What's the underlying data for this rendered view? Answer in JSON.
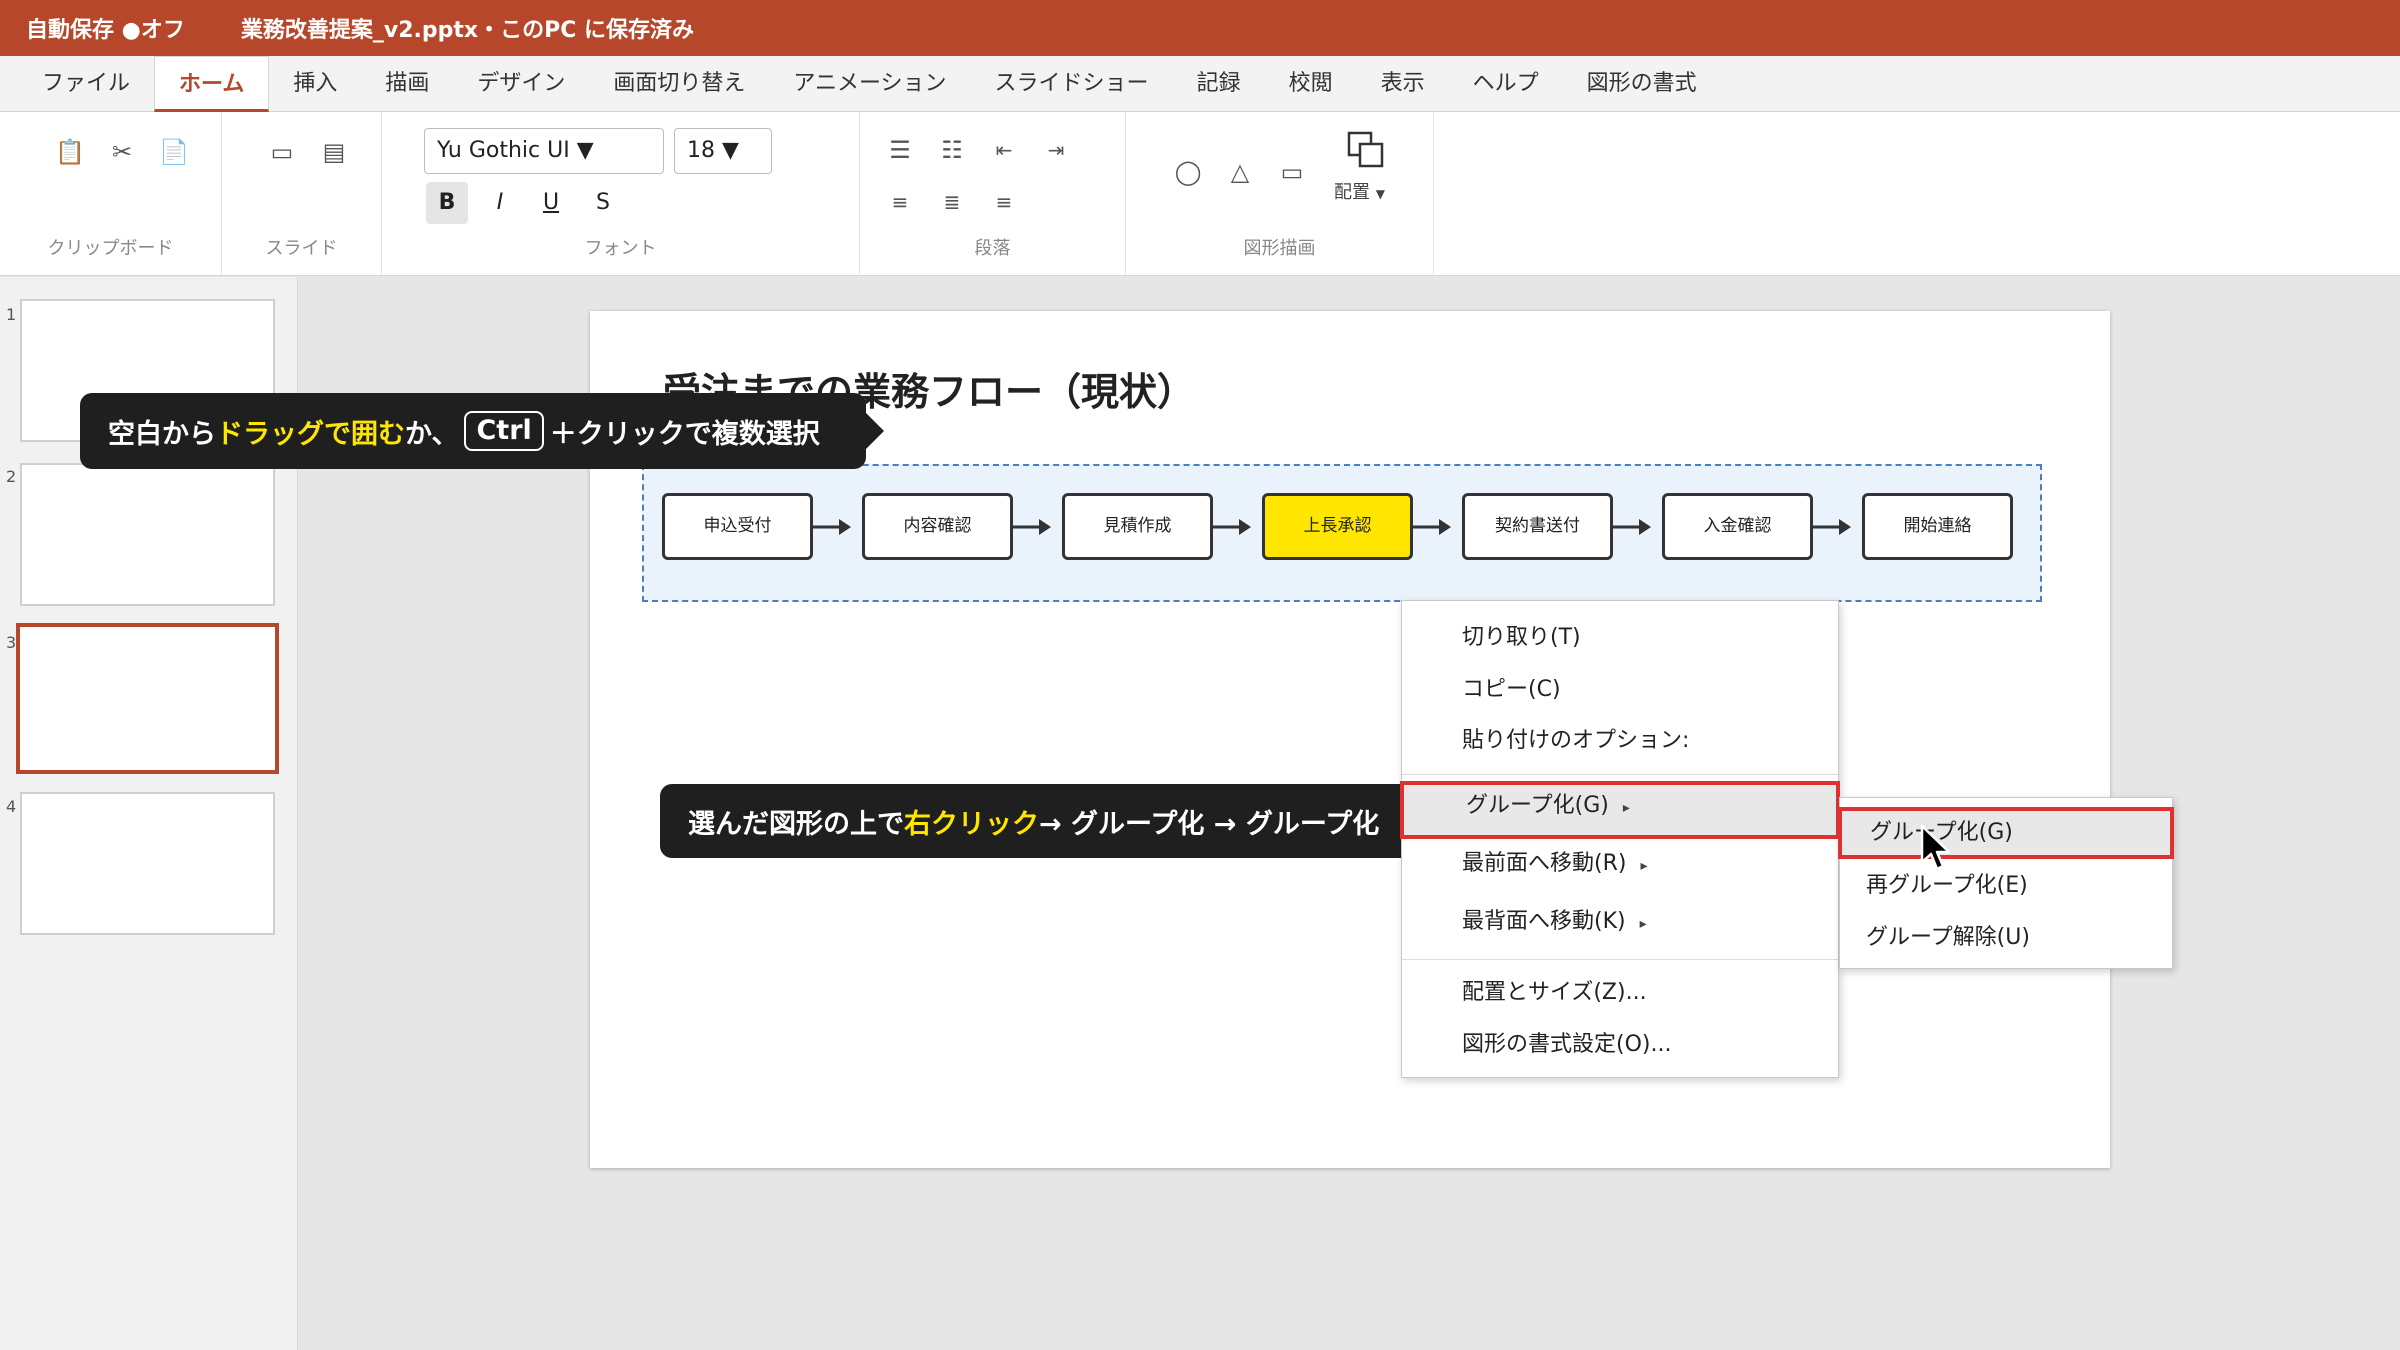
{
  "titlebar": {
    "autosave": "自動保存 ●オフ",
    "doc_title": "業務改善提案_v2.pptx・このPC に保存済み"
  },
  "tabs": [
    "ファイル",
    "ホーム",
    "挿入",
    "描画",
    "デザイン",
    "画面切り替え",
    "アニメーション",
    "スライドショー",
    "記録",
    "校閲",
    "表示",
    "ヘルプ",
    "図形の書式"
  ],
  "active_tab": "ホーム",
  "ribbon": {
    "clipboard_label": "クリップボード",
    "slide_label": "スライド",
    "font_label": "フォント",
    "paragraph_label": "段落",
    "drawing_label": "図形描画",
    "font_name": "Yu Gothic UI ▼",
    "font_size": "18 ▼",
    "bold": "B",
    "italic": "I",
    "underline": "U",
    "strike": "S",
    "arrange": "配置"
  },
  "thumbnails": [
    "1",
    "2",
    "3",
    "4"
  ],
  "active_slide": "3",
  "slide": {
    "title": "受注までの業務フロー（現状）",
    "steps": [
      "申込受付",
      "内容確認",
      "見積作成",
      "上長承認",
      "契約書送付",
      "入金確認",
      "開始連絡"
    ],
    "highlighted_step": "上長承認"
  },
  "callout1": {
    "part1": "空白から",
    "highlight": "ドラッグで囲む",
    "part2": "か、",
    "key": "Ctrl",
    "part3": "＋クリックで複数選択"
  },
  "callout2": {
    "part1": "選んだ図形の上で",
    "highlight": "右クリック",
    "part2": "→ グループ化 → グループ化"
  },
  "context_menu": {
    "cut": "切り取り(T)",
    "copy": "コピー(C)",
    "paste_options": "貼り付けのオプション:",
    "group": "グループ化(G)",
    "bring_front": "最前面へ移動(R)",
    "send_back": "最背面へ移動(K)",
    "size_position": "配置とサイズ(Z)...",
    "format_shape": "図形の書式設定(O)...",
    "arrow": "▸"
  },
  "submenu": {
    "group": "グループ化(G)",
    "regroup": "再グループ化(E)",
    "ungroup": "グループ解除(U)"
  }
}
